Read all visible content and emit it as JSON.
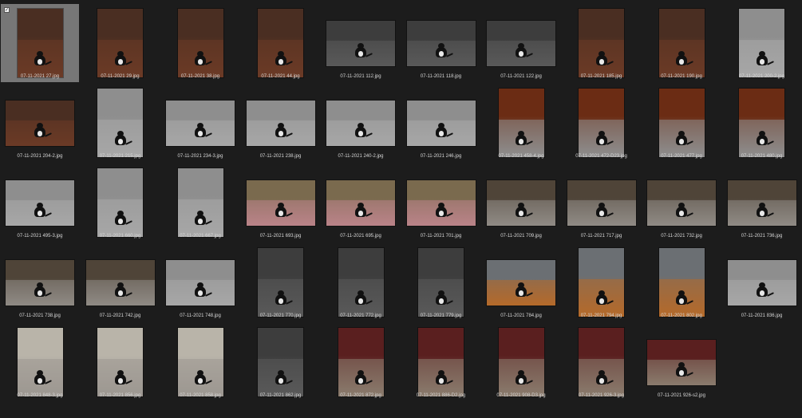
{
  "gallery": {
    "items": [
      {
        "filename": "07-11-2021 27.jpg",
        "orientation": "portrait",
        "scene": "leaves",
        "selected": true,
        "checkbox": "✓"
      },
      {
        "filename": "07-11-2021 29.jpg",
        "orientation": "portrait",
        "scene": "leaves"
      },
      {
        "filename": "07-11-2021 38.jpg",
        "orientation": "portrait",
        "scene": "leaves"
      },
      {
        "filename": "07-11-2021 44.jpg",
        "orientation": "portrait",
        "scene": "leaves"
      },
      {
        "filename": "07-11-2021 112.jpg",
        "orientation": "landscape",
        "scene": "gravel"
      },
      {
        "filename": "07-11-2021 118.jpg",
        "orientation": "landscape",
        "scene": "gravel"
      },
      {
        "filename": "07-11-2021 122.jpg",
        "orientation": "landscape",
        "scene": "gravel"
      },
      {
        "filename": "07-11-2021 185.jpg",
        "orientation": "portrait",
        "scene": "leaves"
      },
      {
        "filename": "07-11-2021 190.jpg",
        "orientation": "portrait",
        "scene": "leaves"
      },
      {
        "filename": "07-11-2021 200-2.jpg",
        "orientation": "portrait",
        "scene": "pavement"
      },
      {
        "filename": "07-11-2021 204-2.jpg",
        "orientation": "landscape",
        "scene": "leaves"
      },
      {
        "filename": "07-11-2021 215.jpg",
        "orientation": "portrait",
        "scene": "pavement"
      },
      {
        "filename": "07-11-2021 234-3.jpg",
        "orientation": "landscape",
        "scene": "pavement"
      },
      {
        "filename": "07-11-2021 238.jpg",
        "orientation": "landscape",
        "scene": "pavement"
      },
      {
        "filename": "07-11-2021 240-2.jpg",
        "orientation": "landscape",
        "scene": "pavement"
      },
      {
        "filename": "07-11-2021 246.jpg",
        "orientation": "landscape",
        "scene": "pavement"
      },
      {
        "filename": "07-11-2021 458-4.jpg",
        "orientation": "portrait",
        "scene": "tree"
      },
      {
        "filename": "07-11-2021 472-D23.jpg",
        "orientation": "portrait",
        "scene": "tree"
      },
      {
        "filename": "07-11-2021 477.jpg",
        "orientation": "portrait",
        "scene": "tree"
      },
      {
        "filename": "07-11-2021 480.jpg",
        "orientation": "portrait",
        "scene": "tree"
      },
      {
        "filename": "07-11-2021 495-3.jpg",
        "orientation": "landscape",
        "scene": "pavement"
      },
      {
        "filename": "07-11-2021 660.jpg",
        "orientation": "portrait",
        "scene": "pavement"
      },
      {
        "filename": "07-11-2021 667.jpg",
        "orientation": "portrait",
        "scene": "pavement"
      },
      {
        "filename": "07-11-2021 693.jpg",
        "orientation": "landscape",
        "scene": "pink"
      },
      {
        "filename": "07-11-2021 695.jpg",
        "orientation": "landscape",
        "scene": "pink"
      },
      {
        "filename": "07-11-2021 701.jpg",
        "orientation": "landscape",
        "scene": "pink"
      },
      {
        "filename": "07-11-2021 709.jpg",
        "orientation": "landscape",
        "scene": "grass"
      },
      {
        "filename": "07-11-2021 717.jpg",
        "orientation": "landscape",
        "scene": "grass"
      },
      {
        "filename": "07-11-2021 732.jpg",
        "orientation": "landscape",
        "scene": "grass"
      },
      {
        "filename": "07-11-2021 736.jpg",
        "orientation": "landscape",
        "scene": "grass"
      },
      {
        "filename": "07-11-2021 738.jpg",
        "orientation": "landscape",
        "scene": "grass"
      },
      {
        "filename": "07-11-2021 742.jpg",
        "orientation": "landscape",
        "scene": "grass"
      },
      {
        "filename": "07-11-2021 748.jpg",
        "orientation": "landscape",
        "scene": "pavement"
      },
      {
        "filename": "07-11-2021 770.jpg",
        "orientation": "portrait",
        "scene": "gravel"
      },
      {
        "filename": "07-11-2021 772.jpg",
        "orientation": "portrait",
        "scene": "gravel"
      },
      {
        "filename": "07-11-2021 779.jpg",
        "orientation": "portrait",
        "scene": "gravel"
      },
      {
        "filename": "07-11-2021 784.jpg",
        "orientation": "landscape",
        "scene": "steps"
      },
      {
        "filename": "07-11-2021 794.jpg",
        "orientation": "portrait",
        "scene": "steps"
      },
      {
        "filename": "07-11-2021 802.jpg",
        "orientation": "portrait",
        "scene": "steps"
      },
      {
        "filename": "07-11-2021 836.jpg",
        "orientation": "landscape",
        "scene": "pavement"
      },
      {
        "filename": "07-11-2021 848-3.jpg",
        "orientation": "portrait",
        "scene": "path"
      },
      {
        "filename": "07-11-2021 856.jpg",
        "orientation": "portrait",
        "scene": "path"
      },
      {
        "filename": "07-11-2021 858.jpg",
        "orientation": "portrait",
        "scene": "path"
      },
      {
        "filename": "07-11-2021 862.jpg",
        "orientation": "portrait",
        "scene": "gravel"
      },
      {
        "filename": "07-11-2021 872.jpg",
        "orientation": "portrait",
        "scene": "door"
      },
      {
        "filename": "07-11-2021 886-D2.jpg",
        "orientation": "portrait",
        "scene": "door"
      },
      {
        "filename": "07-11-2021 908-D3.jpg",
        "orientation": "portrait",
        "scene": "door"
      },
      {
        "filename": "07-11-2021 926-3.jpg",
        "orientation": "portrait",
        "scene": "door"
      },
      {
        "filename": "07-11-2021 926-s2.jpg",
        "orientation": "landscape",
        "scene": "door"
      }
    ]
  },
  "scenes": {
    "leaves": {
      "top": "#4a2e22",
      "bottom": "#6b3b26"
    },
    "gravel": {
      "top": "#3d3d3d",
      "bottom": "#5a5a5a"
    },
    "pavement": {
      "top": "#8e8e8e",
      "bottom": "#a7a7a7"
    },
    "tree": {
      "top": "#6b2c14",
      "bottom": "#8e8e8e"
    },
    "pink": {
      "top": "#7a6a4e",
      "bottom": "#b98388"
    },
    "grass": {
      "top": "#4f4438",
      "bottom": "#8f8b85"
    },
    "steps": {
      "top": "#6b6f73",
      "bottom": "#b56a2a"
    },
    "path": {
      "top": "#b9b4a9",
      "bottom": "#9d9891"
    },
    "door": {
      "top": "#5a1f1f",
      "bottom": "#8a7b6d"
    }
  }
}
